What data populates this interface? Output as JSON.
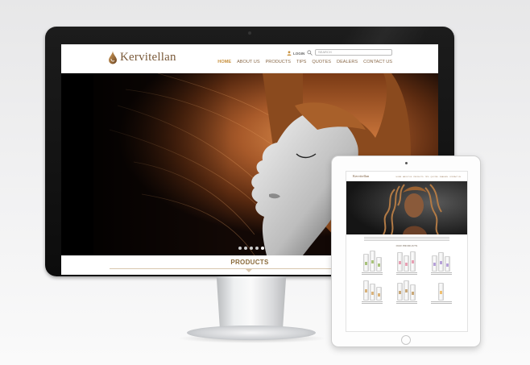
{
  "desktop": {
    "brand": "Kervitellan",
    "login_label": "LOGIN",
    "search_placeholder": "SEARCH",
    "nav": [
      "HOME",
      "ABOUT US",
      "PRODUCTS",
      "TIPS",
      "QUOTES",
      "DEALERS",
      "CONTACT US"
    ],
    "active_nav": "HOME",
    "slider_dots": 5,
    "slider_active": 1,
    "section_title": "PRODUCTS"
  },
  "tablet": {
    "brand": "Kervitellan",
    "nav": [
      "HOME",
      "ABOUT US",
      "PRODUCTS",
      "TIPS",
      "QUOTES",
      "DEALERS",
      "CONTACT US"
    ],
    "section_title": "OUR PRODUCTS",
    "product_label_colors": [
      "#a8c27a",
      "#e8a0b4",
      "#b6a0d8",
      "#d9b27a",
      "#c9a878",
      "#f0c070"
    ]
  },
  "colors": {
    "brand_brown": "#7a5a3a",
    "nav_active": "#c8913e",
    "hair_copper": "#a85a2a"
  }
}
